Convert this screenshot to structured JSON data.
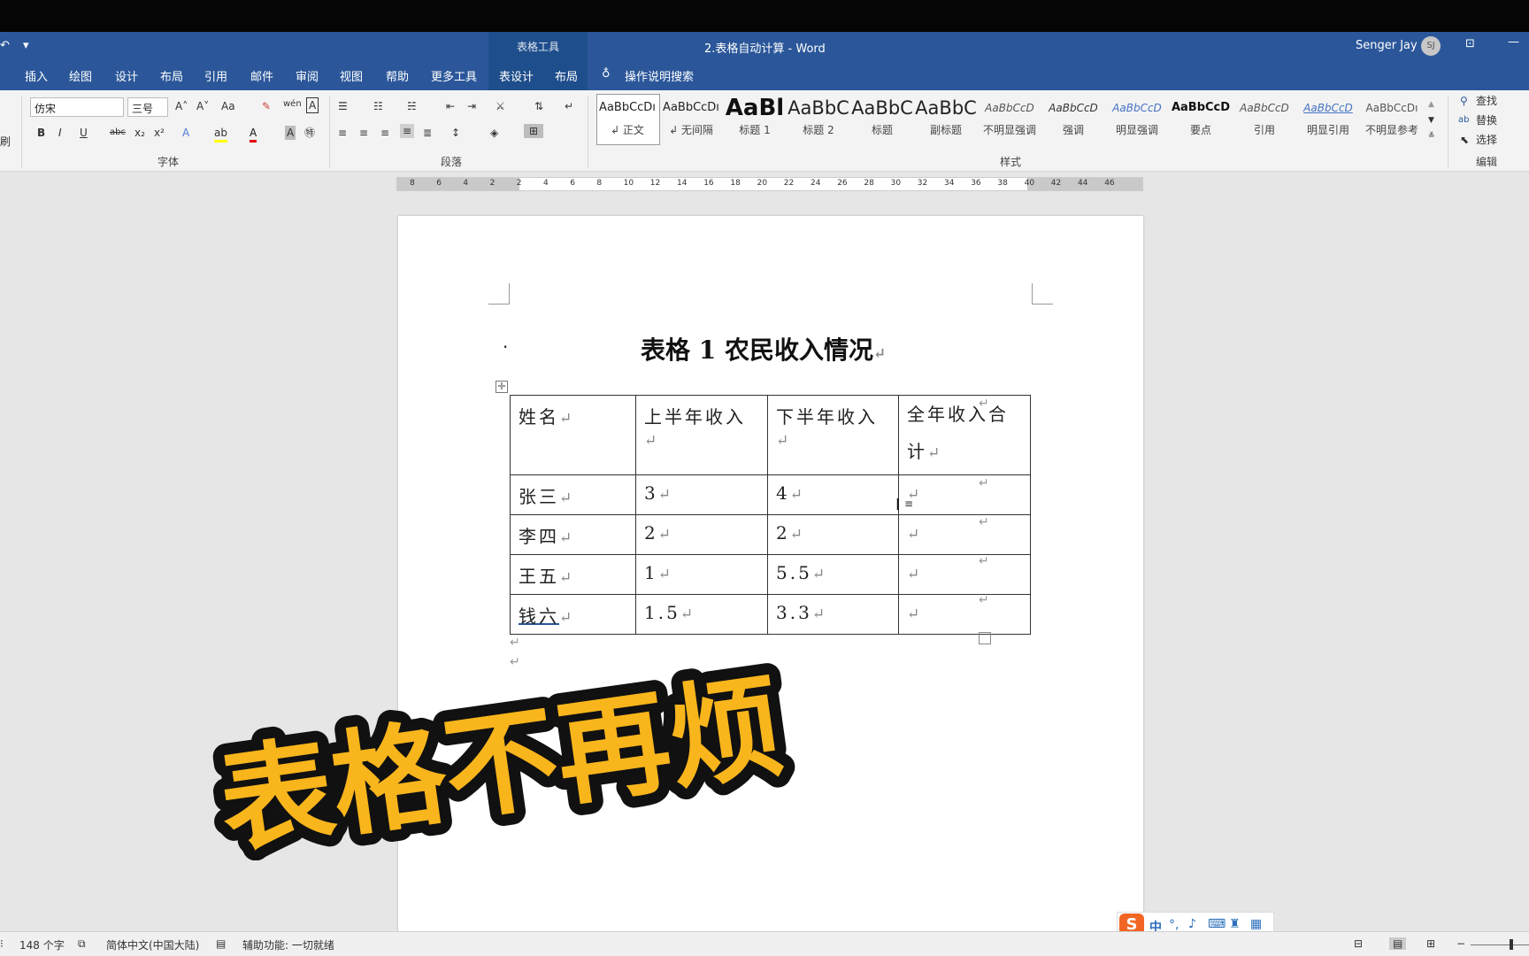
{
  "window": {
    "context_group": "表格工具",
    "title": "2.表格自动计算  -  Word",
    "user": "Senger Jay",
    "avatar": "SJ"
  },
  "tabs": [
    "插入",
    "绘图",
    "设计",
    "布局",
    "引用",
    "邮件",
    "审阅",
    "视图",
    "帮助",
    "更多工具",
    "表设计",
    "布局"
  ],
  "tell_me": "操作说明搜索",
  "ribbon": {
    "left_partial": "刷",
    "font_name": "仿宋",
    "font_size": "三号",
    "font_group": "字体",
    "para_group": "段落",
    "styles_group": "样式",
    "edit_group": "编辑",
    "styles": [
      {
        "preview": "AaBbCcDı",
        "name": "↲ 正文"
      },
      {
        "preview": "AaBbCcDı",
        "name": "↲ 无间隔"
      },
      {
        "preview": "AaBl",
        "name": "标题 1"
      },
      {
        "preview": "AaBbC",
        "name": "标题 2"
      },
      {
        "preview": "AaBbC",
        "name": "标题"
      },
      {
        "preview": "AaBbC",
        "name": "副标题"
      },
      {
        "preview": "AaBbCcD",
        "name": "不明显强调"
      },
      {
        "preview": "AaBbCcD",
        "name": "强调"
      },
      {
        "preview": "AaBbCcD",
        "name": "明显强调"
      },
      {
        "preview": "AaBbCcD",
        "name": "要点"
      },
      {
        "preview": "AaBbCcD",
        "name": "引用"
      },
      {
        "preview": "AaBbCcD",
        "name": "明显引用"
      },
      {
        "preview": "AaBbCcDı",
        "name": "不明显参考"
      }
    ],
    "find": "查找",
    "replace": "替换",
    "select": "选择"
  },
  "ruler": [
    "8",
    "6",
    "4",
    "2",
    "2",
    "4",
    "6",
    "8",
    "10",
    "12",
    "14",
    "16",
    "18",
    "20",
    "22",
    "24",
    "26",
    "28",
    "30",
    "32",
    "34",
    "36",
    "38",
    "40",
    "42",
    "44",
    "46"
  ],
  "document": {
    "title": "表格 1 农民收入情况",
    "mark": "↵",
    "headers": [
      "姓名",
      "上半年收入",
      "下半年收入",
      "全年收入合计"
    ],
    "rows": [
      [
        "张三",
        "3",
        "4",
        ""
      ],
      [
        "李四",
        "2",
        "2",
        ""
      ],
      [
        "王五",
        "1",
        "5.5",
        ""
      ],
      [
        "钱六",
        "1.5",
        "3.3",
        ""
      ]
    ]
  },
  "overlay_caption": "表格不再烦",
  "status": {
    "word_count": "148 个字",
    "language": "简体中文(中国大陆)",
    "accessibility": "辅助功能: 一切就绪"
  },
  "ime": {
    "lang": "中"
  }
}
